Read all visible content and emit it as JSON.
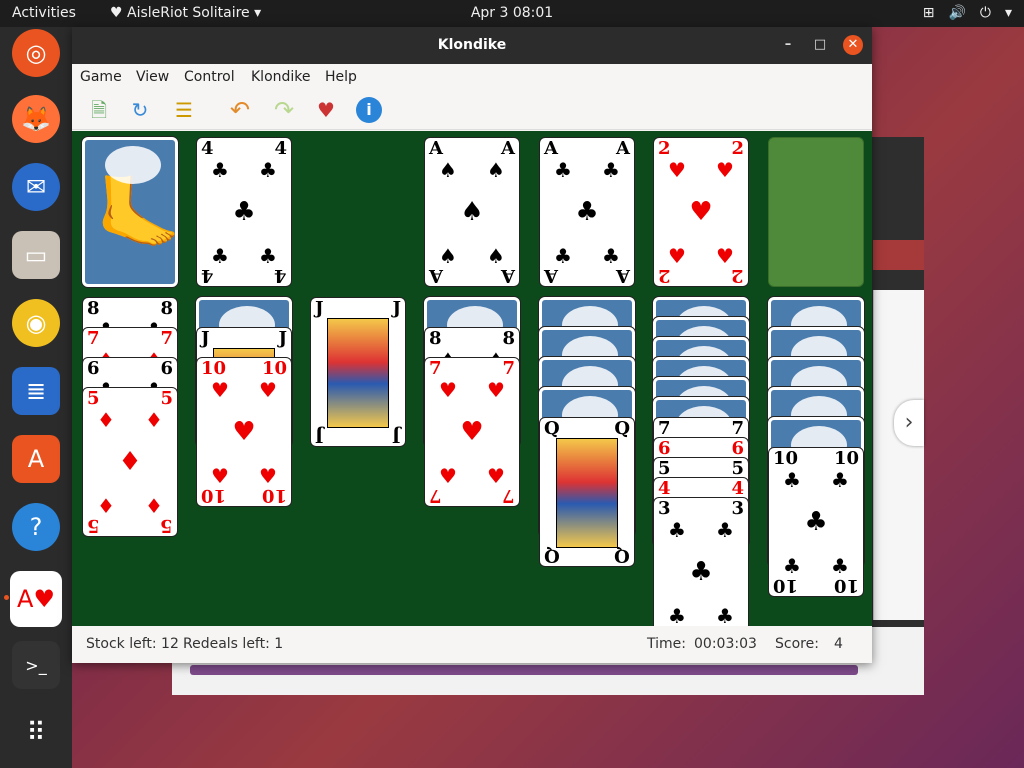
{
  "topbar": {
    "activities": "Activities",
    "app_menu": "AisleRiot Solitaire",
    "clock": "Apr 3  08:01"
  },
  "window": {
    "title": "Klondike",
    "minimize": "–",
    "maximize": "□",
    "close": "✕"
  },
  "menu": [
    "Game",
    "View",
    "Control",
    "Klondike",
    "Help"
  ],
  "status": {
    "stock_left": "Stock left: 12",
    "redeals_left": "Redeals left: 1",
    "time_label": "Time:",
    "time_value": "00:03:03",
    "score_label": "Score:",
    "score_value": "4"
  },
  "foundations": [
    {
      "rank": "A",
      "suit": "♠",
      "color": "black"
    },
    {
      "rank": "A",
      "suit": "♣",
      "color": "black"
    },
    {
      "rank": "2",
      "suit": "♥",
      "color": "red"
    }
  ],
  "waste": {
    "rank": "4",
    "suit": "♣",
    "color": "black"
  },
  "tableau": [
    {
      "visible": [
        {
          "rank": "8",
          "suit": "♣",
          "color": "black"
        },
        {
          "rank": "7",
          "suit": "♦",
          "color": "red"
        },
        {
          "rank": "6",
          "suit": "♣",
          "color": "black"
        },
        {
          "rank": "5",
          "suit": "♦",
          "color": "red"
        }
      ]
    },
    {
      "visible": [
        {
          "rank": "J",
          "suit": "♣",
          "color": "black"
        },
        {
          "rank": "10",
          "suit": "♥",
          "color": "red"
        }
      ]
    },
    {
      "visible": [
        {
          "rank": "J",
          "suit": "♣",
          "color": "black"
        }
      ]
    },
    {
      "visible": [
        {
          "rank": "8",
          "suit": "♠",
          "color": "black"
        },
        {
          "rank": "7",
          "suit": "♥",
          "color": "red"
        }
      ]
    },
    {
      "visible": [
        {
          "rank": "Q",
          "suit": "♣",
          "color": "black"
        }
      ]
    },
    {
      "visible": [
        {
          "rank": "7",
          "suit": "♠",
          "color": "black"
        },
        {
          "rank": "6",
          "suit": "♥",
          "color": "red"
        },
        {
          "rank": "5",
          "suit": "♠",
          "color": "black"
        },
        {
          "rank": "4",
          "suit": "♥",
          "color": "red"
        },
        {
          "rank": "3",
          "suit": "♣",
          "color": "black"
        }
      ]
    },
    {
      "visible": [
        {
          "rank": "10",
          "suit": "♣",
          "color": "black"
        }
      ]
    }
  ]
}
